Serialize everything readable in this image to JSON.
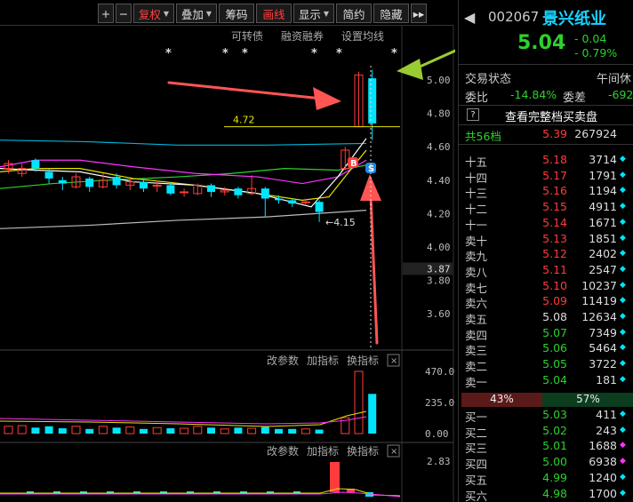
{
  "toolbar": {
    "buttons": [
      {
        "label": "+",
        "selected": false,
        "dropdown": false
      },
      {
        "label": "−",
        "selected": false,
        "dropdown": false
      },
      {
        "label": "复权",
        "selected": true,
        "dropdown": true
      },
      {
        "label": "叠加",
        "selected": false,
        "dropdown": true
      },
      {
        "label": "筹码",
        "selected": false,
        "dropdown": false
      },
      {
        "label": "画线",
        "selected": true,
        "dropdown": false
      },
      {
        "label": "显示",
        "selected": false,
        "dropdown": true
      },
      {
        "label": "简约",
        "selected": false,
        "dropdown": false
      },
      {
        "label": "隐藏",
        "selected": false,
        "dropdown": false
      }
    ],
    "more_label": "▸▸"
  },
  "chart": {
    "links": [
      "可转债",
      "融资融券",
      "设置均线"
    ],
    "price_axis": [
      "5.00",
      "4.80",
      "4.60",
      "4.40",
      "4.20",
      "4.00",
      "3.80",
      "3.60"
    ],
    "current_price_tag": "3.87",
    "annotation_high": "4.72",
    "annotation_low": "4.15",
    "marker_b": "B",
    "marker_s": "S",
    "stars": "*",
    "candles": [
      {
        "o": 4.47,
        "c": 4.5,
        "h": 4.52,
        "l": 4.44
      },
      {
        "o": 4.44,
        "c": 4.47,
        "h": 4.5,
        "l": 4.42
      },
      {
        "o": 4.52,
        "c": 4.47,
        "h": 4.53,
        "l": 4.45
      },
      {
        "o": 4.45,
        "c": 4.41,
        "h": 4.47,
        "l": 4.38
      },
      {
        "o": 4.4,
        "c": 4.38,
        "h": 4.42,
        "l": 4.34
      },
      {
        "o": 4.36,
        "c": 4.42,
        "h": 4.44,
        "l": 4.35
      },
      {
        "o": 4.41,
        "c": 4.36,
        "h": 4.42,
        "l": 4.33
      },
      {
        "o": 4.36,
        "c": 4.4,
        "h": 4.44,
        "l": 4.35
      },
      {
        "o": 4.42,
        "c": 4.37,
        "h": 4.44,
        "l": 4.35
      },
      {
        "o": 4.37,
        "c": 4.39,
        "h": 4.42,
        "l": 4.34
      },
      {
        "o": 4.39,
        "c": 4.35,
        "h": 4.4,
        "l": 4.33
      },
      {
        "o": 4.37,
        "c": 4.37,
        "h": 4.4,
        "l": 4.33
      },
      {
        "o": 4.37,
        "c": 4.32,
        "h": 4.39,
        "l": 4.31
      },
      {
        "o": 4.33,
        "c": 4.33,
        "h": 4.35,
        "l": 4.3
      },
      {
        "o": 4.32,
        "c": 4.37,
        "h": 4.38,
        "l": 4.31
      },
      {
        "o": 4.37,
        "c": 4.33,
        "h": 4.38,
        "l": 4.3
      },
      {
        "o": 4.33,
        "c": 4.34,
        "h": 4.36,
        "l": 4.31
      },
      {
        "o": 4.35,
        "c": 4.31,
        "h": 4.36,
        "l": 4.29
      },
      {
        "o": 4.32,
        "c": 4.35,
        "h": 4.43,
        "l": 4.31
      },
      {
        "o": 4.35,
        "c": 4.29,
        "h": 4.36,
        "l": 4.18
      },
      {
        "o": 4.29,
        "c": 4.28,
        "h": 4.31,
        "l": 4.26
      },
      {
        "o": 4.28,
        "c": 4.26,
        "h": 4.29,
        "l": 4.24
      },
      {
        "o": 4.27,
        "c": 4.27,
        "h": 4.29,
        "l": 4.25
      },
      {
        "o": 4.27,
        "c": 4.21,
        "h": 4.28,
        "l": 4.15
      },
      {
        "o": 4.47,
        "c": 4.58,
        "h": 4.6,
        "l": 4.46
      },
      {
        "o": 4.72,
        "c": 5.03,
        "h": 5.05,
        "l": 4.72
      },
      {
        "o": 5.01,
        "c": 4.74,
        "h": 5.06,
        "l": 4.64
      }
    ],
    "volume_axis": [
      "470.00",
      "235.00",
      "0.00"
    ],
    "volumes": [
      55,
      60,
      45,
      55,
      40,
      55,
      35,
      55,
      45,
      50,
      35,
      45,
      40,
      40,
      55,
      45,
      35,
      45,
      40,
      50,
      35,
      35,
      35,
      30,
      120,
      470,
      300
    ],
    "macd_axis": [
      "2.83"
    ],
    "sub_links": [
      "改参数",
      "加指标",
      "换指标"
    ]
  },
  "quote": {
    "code": "002067",
    "name": "景兴纸业",
    "price": "5.04",
    "change": "- 0.04",
    "change_pct": "- 0.79%",
    "status_label": "交易状态",
    "status_value": "午间休",
    "ratio_label": "委比",
    "ratio_value": "-14.84%",
    "diff_label": "委差",
    "diff_value": "-692",
    "full_book_label": "查看完整档买卖盘",
    "full_book_icon": "?",
    "levels_label": "共56档",
    "levels_price": "5.39",
    "levels_vol": "267924",
    "asks": [
      {
        "label": "十五",
        "price": "5.18",
        "vol": "3714",
        "dot": "cyan"
      },
      {
        "label": "十四",
        "price": "5.17",
        "vol": "1791",
        "dot": "cyan"
      },
      {
        "label": "十三",
        "price": "5.16",
        "vol": "1194",
        "dot": "cyan"
      },
      {
        "label": "十二",
        "price": "5.15",
        "vol": "4911",
        "dot": "cyan"
      },
      {
        "label": "十一",
        "price": "5.14",
        "vol": "1671",
        "dot": "cyan"
      },
      {
        "label": "卖十",
        "price": "5.13",
        "vol": "1851",
        "dot": "cyan"
      },
      {
        "label": "卖九",
        "price": "5.12",
        "vol": "2402",
        "dot": "cyan"
      },
      {
        "label": "卖八",
        "price": "5.11",
        "vol": "2547",
        "dot": "cyan"
      },
      {
        "label": "卖七",
        "price": "5.10",
        "vol": "10237",
        "dot": "cyan"
      },
      {
        "label": "卖六",
        "price": "5.09",
        "vol": "11419",
        "dot": "cyan"
      },
      {
        "label": "卖五",
        "price": "5.08",
        "vol": "12634",
        "dot": "cyan"
      },
      {
        "label": "卖四",
        "price": "5.07",
        "vol": "7349",
        "dot": "cyan"
      },
      {
        "label": "卖三",
        "price": "5.06",
        "vol": "5464",
        "dot": "cyan"
      },
      {
        "label": "卖二",
        "price": "5.05",
        "vol": "3722",
        "dot": "cyan"
      },
      {
        "label": "卖一",
        "price": "5.04",
        "vol": "181",
        "dot": "cyan"
      }
    ],
    "balance_left": "43%",
    "balance_right": "57%",
    "bids": [
      {
        "label": "买一",
        "price": "5.03",
        "vol": "411",
        "dot": "cyan"
      },
      {
        "label": "买二",
        "price": "5.02",
        "vol": "243",
        "dot": "cyan"
      },
      {
        "label": "买三",
        "price": "5.01",
        "vol": "1688",
        "dot": "magenta"
      },
      {
        "label": "买四",
        "price": "5.00",
        "vol": "6938",
        "dot": "magenta"
      },
      {
        "label": "买五",
        "price": "4.99",
        "vol": "1240",
        "dot": "cyan"
      },
      {
        "label": "买六",
        "price": "4.98",
        "vol": "1700",
        "dot": "cyan"
      }
    ],
    "colors": {
      "up": "#ff3b3b",
      "down": "#2bd22b",
      "cyan": "#00e5ff",
      "magenta": "#ff33ff",
      "name": "#19d3ff"
    }
  }
}
